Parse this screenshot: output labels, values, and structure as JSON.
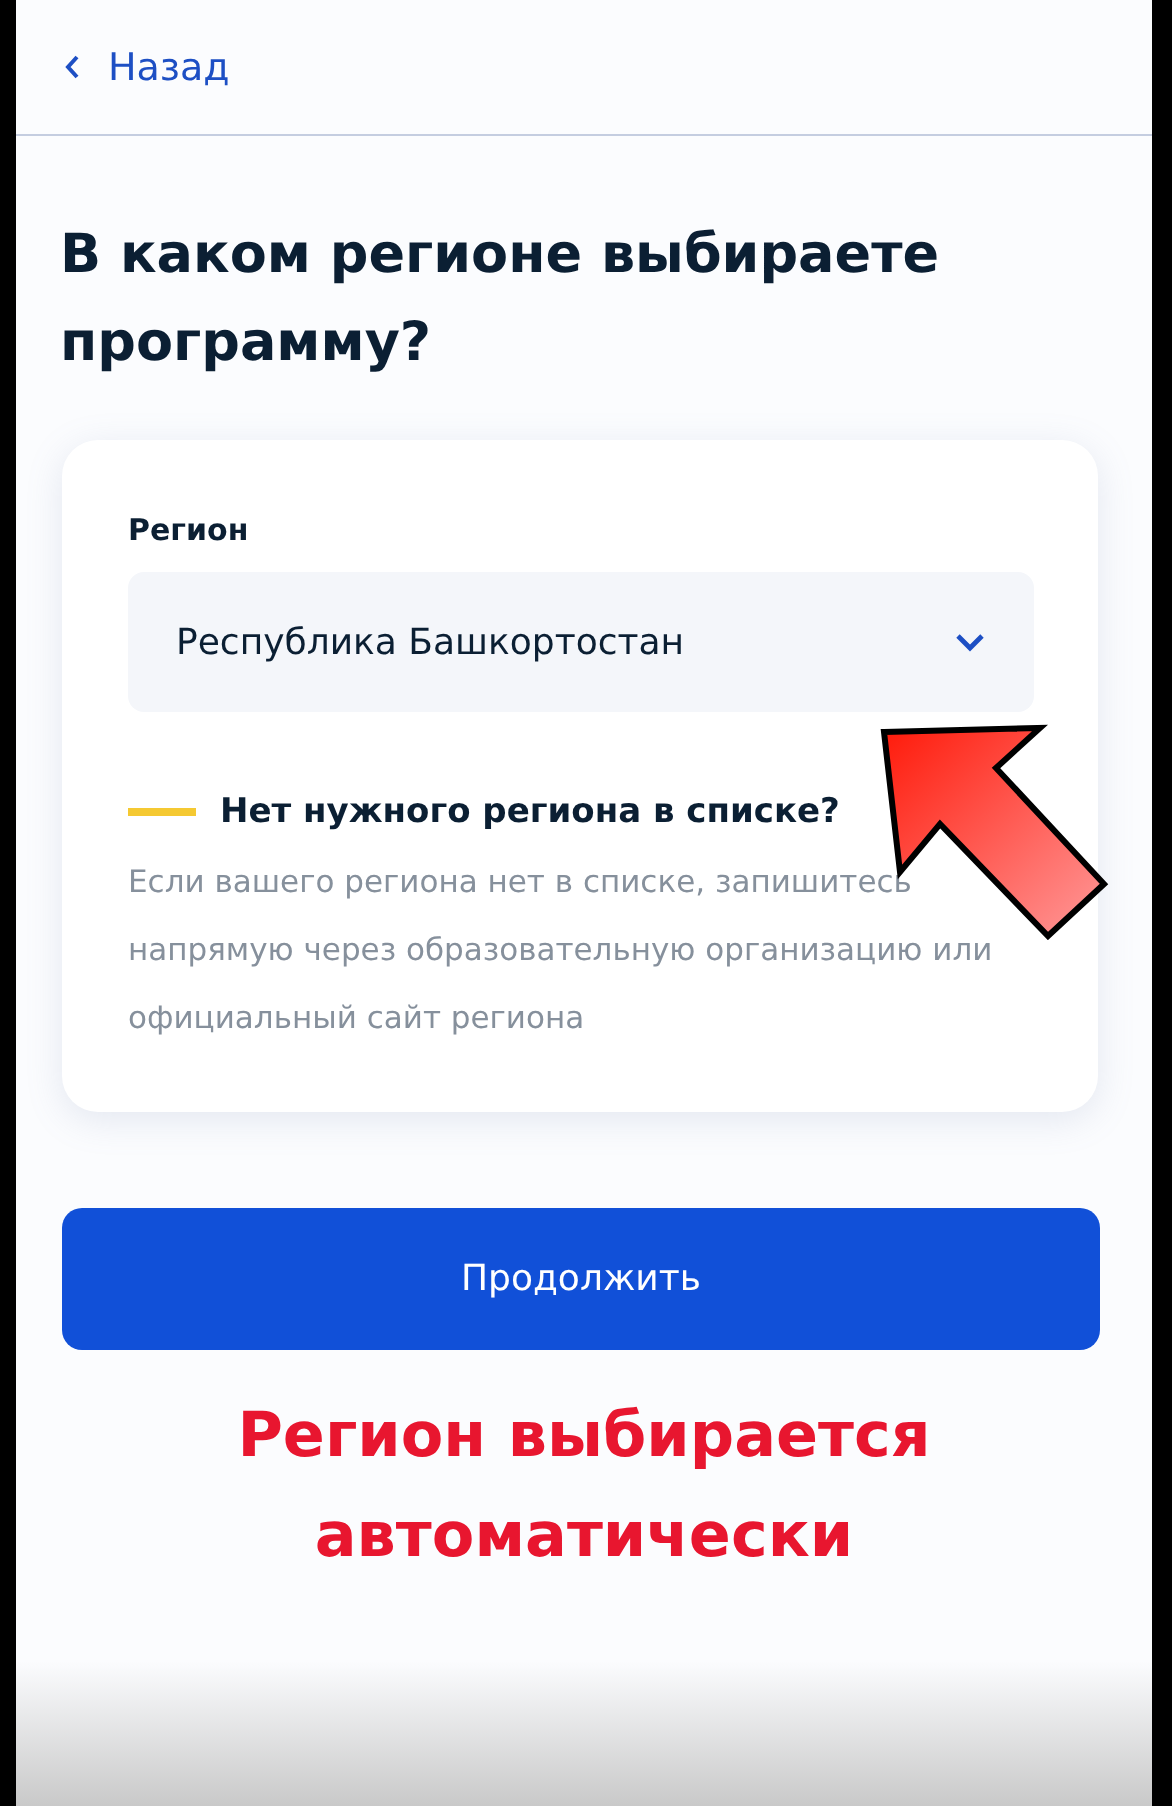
{
  "header": {
    "back_label": "Назад"
  },
  "title": "В каком регионе выбираете программу?",
  "card": {
    "field_label": "Регион",
    "field_value": "Республика Башкортостан",
    "notice": {
      "heading": "Нет нужного региона в списке?",
      "text": "Если вашего региона нет в списке, запишитесь напрямую через образовательную организацию или официальный сайт региона"
    }
  },
  "continue_button": "Продолжить",
  "annotation": {
    "caption": "Регион выбирается автоматически"
  }
}
